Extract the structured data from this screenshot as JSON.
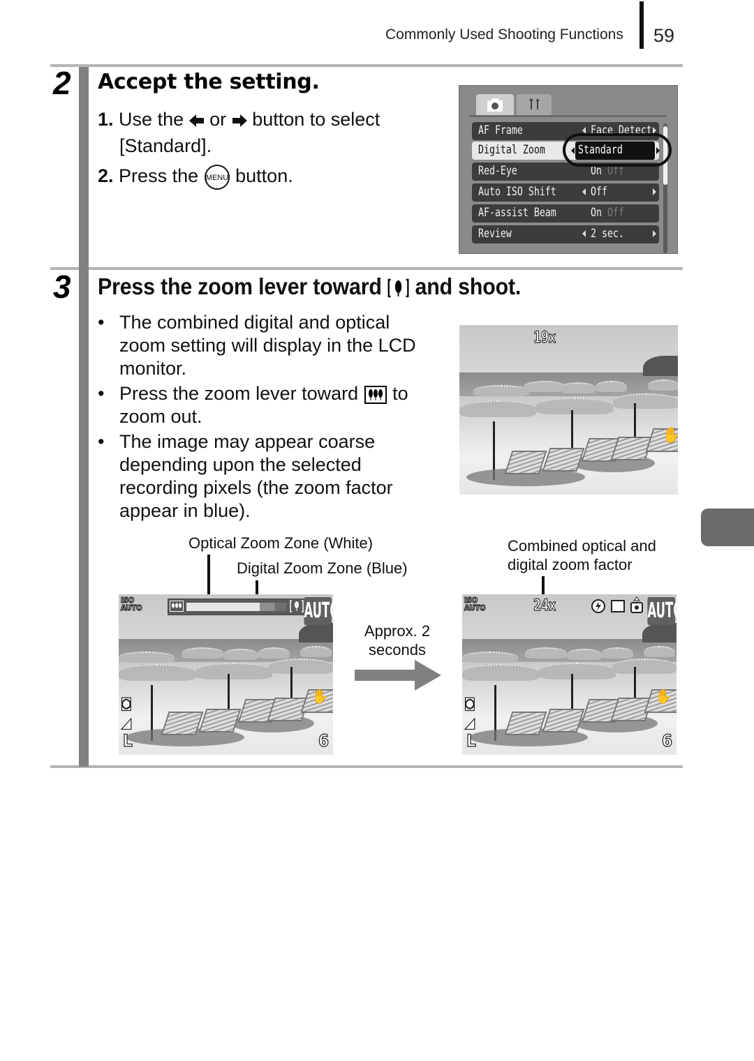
{
  "header": {
    "section_title": "Commonly Used Shooting Functions",
    "page_number": "59"
  },
  "step2": {
    "number": "2",
    "title": "Accept the setting.",
    "instructions": [
      {
        "num": "1.",
        "pre": "Use the",
        "mid": "or",
        "post": "button to select",
        "line2": "[Standard].",
        "icons": [
          "left-arrow-button-icon",
          "right-arrow-button-icon"
        ]
      },
      {
        "num": "2.",
        "pre": "Press the",
        "post": "button.",
        "icon": "menu-button-icon",
        "icon_text": "MENU"
      }
    ],
    "camera_menu": {
      "tabs": [
        "camera-tab-icon",
        "settings-tab-icon"
      ],
      "rows": [
        {
          "label": "AF Frame",
          "value": "Face Detect"
        },
        {
          "label": "Digital Zoom",
          "value": "Standard",
          "selected": true
        },
        {
          "label": "Red-Eye",
          "value_on": "On",
          "value_off": "Off"
        },
        {
          "label": "Auto ISO Shift",
          "value": "Off"
        },
        {
          "label": "AF-assist Beam",
          "value_on": "On",
          "value_off": "Off"
        },
        {
          "label": "Review",
          "value": "2 sec."
        }
      ]
    }
  },
  "step3": {
    "number": "3",
    "title_pre": "Press the zoom lever toward",
    "title_icon": "telephoto-icon",
    "title_post": "and shoot.",
    "bullets": [
      {
        "lines": [
          "The combined digital and optical",
          "zoom setting will display in the LCD",
          "monitor."
        ]
      },
      {
        "pre": "Press the zoom lever toward",
        "icon": "wide-angle-icon",
        "post": "to",
        "line2": "zoom out."
      },
      {
        "lines": [
          "The image may appear coarse",
          "depending upon the selected",
          "recording pixels (the zoom factor",
          "appear in blue)."
        ]
      }
    ],
    "lcd_top": {
      "zoom_factor": "19x"
    },
    "callouts": {
      "optical_zone": "Optical Zoom Zone (White)",
      "digital_zone": "Digital Zoom Zone (Blue)",
      "transition": "Approx. 2 seconds",
      "transition_lines": [
        "Approx. 2",
        "seconds"
      ],
      "combined": [
        "Combined optical and",
        "digital zoom factor"
      ]
    },
    "lcd_left": {
      "iso": [
        "ISO",
        "AUTO"
      ],
      "mode": "AUTO",
      "zoom_bar": {
        "optical_fraction": 0.73,
        "digital_fraction": 0.27
      },
      "shots_remaining": "6",
      "size": "L"
    },
    "lcd_right": {
      "iso": [
        "ISO",
        "AUTO"
      ],
      "zoom_factor": "24x",
      "mode": "AUTO",
      "shots_remaining": "6",
      "size": "L"
    }
  }
}
